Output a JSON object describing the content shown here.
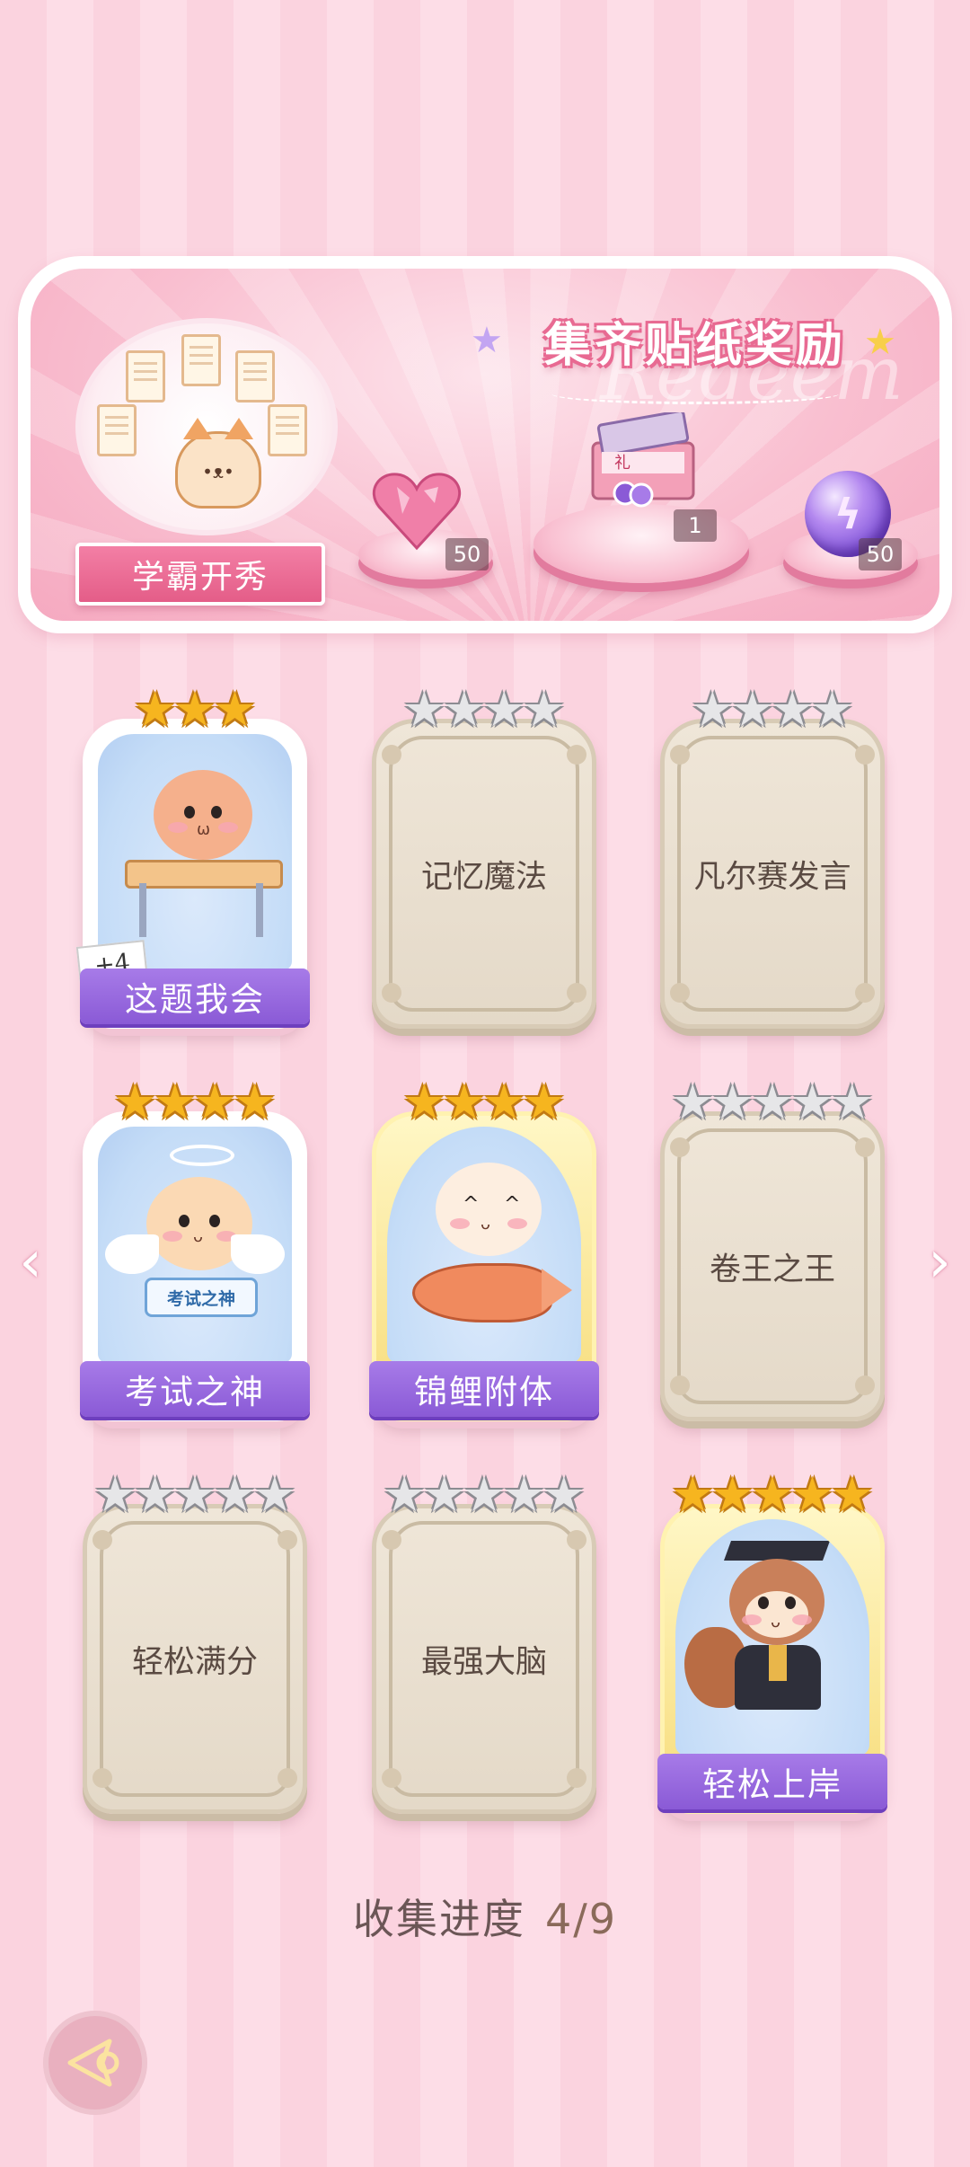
{
  "banner": {
    "title": "集齐贴纸奖励",
    "watermark": "Redeem",
    "badge_label": "学霸开秀",
    "rewards": [
      {
        "icon": "pink-heart-gem-icon",
        "count": "50"
      },
      {
        "icon": "gift-box-icon",
        "count": "1"
      },
      {
        "icon": "purple-lightning-orb-icon",
        "count": "50"
      }
    ]
  },
  "cards": [
    {
      "label": "这题我会",
      "stars": 3,
      "max_stars": 3,
      "collected": true,
      "bonus": "+4"
    },
    {
      "label": "记忆魔法",
      "stars": 0,
      "max_stars": 4,
      "collected": false
    },
    {
      "label": "凡尔赛发言",
      "stars": 0,
      "max_stars": 4,
      "collected": false
    },
    {
      "label": "考试之神",
      "stars": 4,
      "max_stars": 4,
      "collected": true,
      "sign_text": "考试之神"
    },
    {
      "label": "锦鲤附体",
      "stars": 4,
      "max_stars": 4,
      "collected": true
    },
    {
      "label": "卷王之王",
      "stars": 0,
      "max_stars": 5,
      "collected": false
    },
    {
      "label": "轻松满分",
      "stars": 0,
      "max_stars": 5,
      "collected": false
    },
    {
      "label": "最强大脑",
      "stars": 0,
      "max_stars": 5,
      "collected": false
    },
    {
      "label": "轻松上岸",
      "stars": 5,
      "max_stars": 5,
      "collected": true
    }
  ],
  "progress": {
    "label": "收集进度",
    "value": "4/9",
    "collected": 4,
    "total": 9
  },
  "nav": {
    "prev_icon": "chevron-left-icon",
    "next_icon": "chevron-right-icon",
    "back_icon": "back-arrow-icon"
  },
  "colors": {
    "accent_purple": "#8a5ad6",
    "pink": "#f37fa5",
    "gold_star": "#f6b51f"
  }
}
